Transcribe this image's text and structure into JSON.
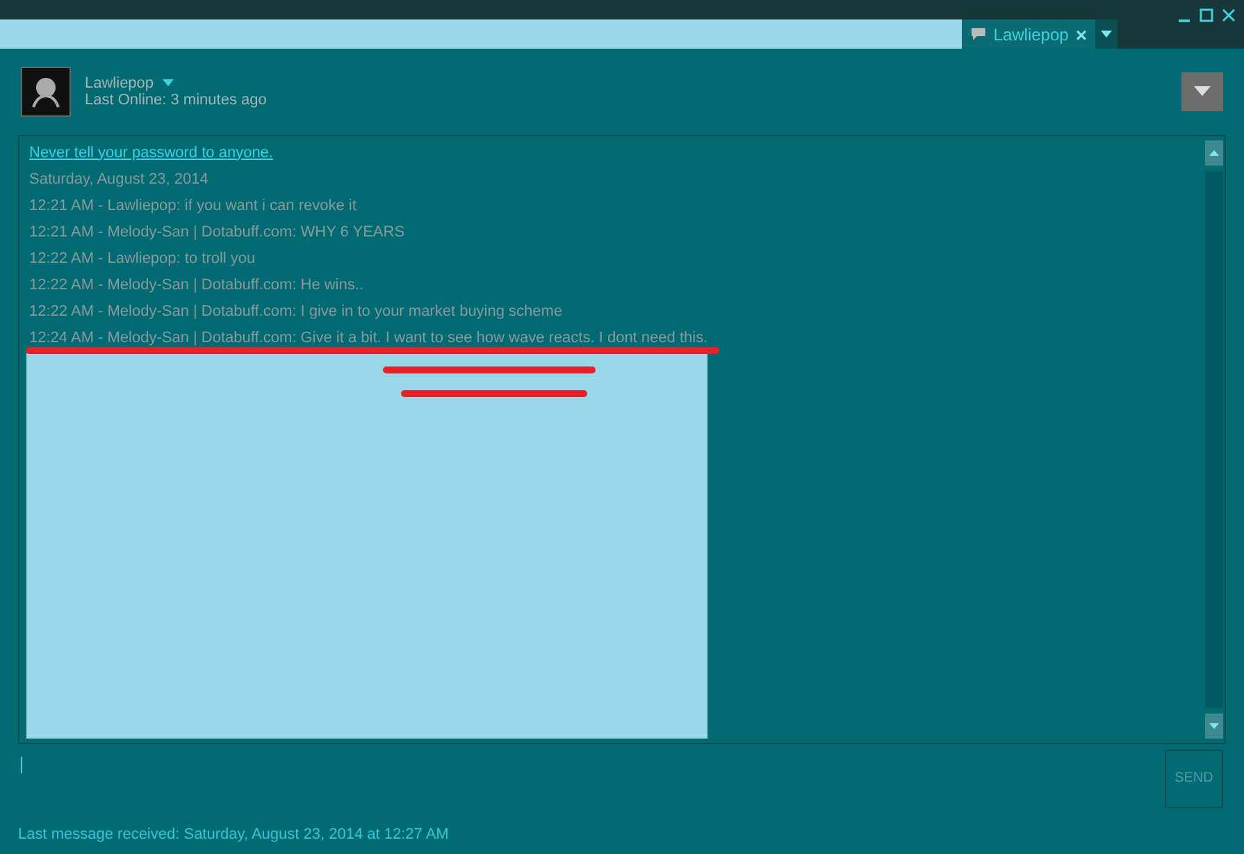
{
  "tab": {
    "label": "Lawliepop",
    "close": "×"
  },
  "contact": {
    "name": "Lawliepop",
    "status": "Last Online: 3 minutes ago"
  },
  "log": {
    "warning": "Never tell your password to anyone.",
    "date": "Saturday, August 23, 2014",
    "messages": [
      "12:21 AM - Lawliepop: if you want i can revoke it",
      "12:21 AM - Melody-San | Dotabuff.com: WHY 6 YEARS",
      "12:22 AM - Lawliepop: to troll you",
      "12:22 AM - Melody-San | Dotabuff.com: He wins..",
      "12:22 AM - Melody-San | Dotabuff.com: I give in to your market buying scheme",
      "12:24 AM - Melody-San | Dotabuff.com: Give it a bit. I want to see how wave reacts. I dont need this."
    ]
  },
  "send_button": "SEND",
  "status_bar": "Last message received: Saturday, August 23, 2014 at 12:27 AM"
}
